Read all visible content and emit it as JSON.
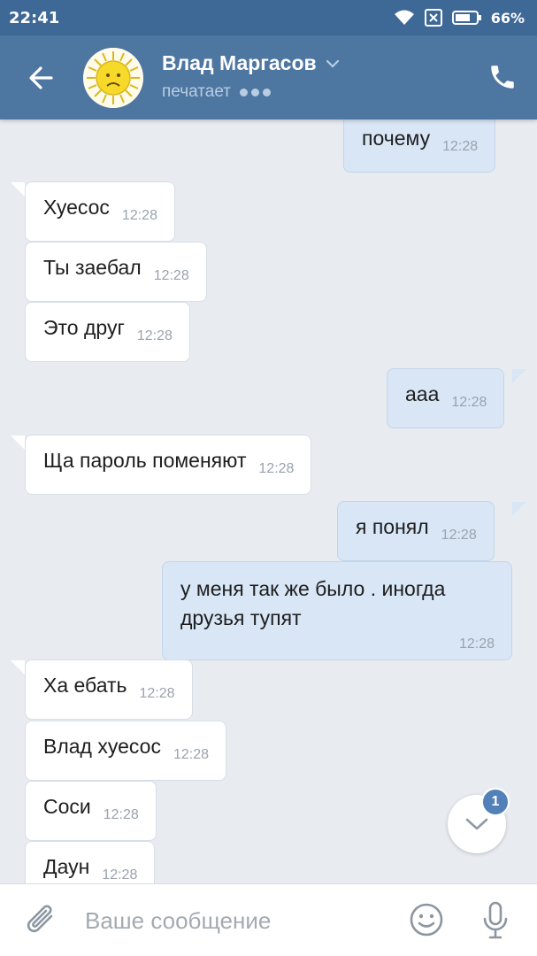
{
  "status_bar": {
    "time": "22:41",
    "battery": "66%",
    "icons": [
      "wifi-icon",
      "no-sim-icon",
      "battery-icon"
    ]
  },
  "header": {
    "contact_name": "Влад Маргасов",
    "status": "печатает",
    "icons": [
      "back-arrow-icon",
      "chevron-down-icon",
      "phone-icon"
    ]
  },
  "messages": [
    {
      "direction": "out",
      "text": "почему",
      "time": "12:28"
    },
    {
      "direction": "in",
      "text": "Хуесос",
      "time": "12:28"
    },
    {
      "direction": "in",
      "text": "Ты заебал",
      "time": "12:28"
    },
    {
      "direction": "in",
      "text": "Это друг",
      "time": "12:28"
    },
    {
      "direction": "out",
      "text": "ааа",
      "time": "12:28"
    },
    {
      "direction": "in",
      "text": "Ща пароль поменяют",
      "time": "12:28"
    },
    {
      "direction": "out",
      "text": "я понял",
      "time": "12:28"
    },
    {
      "direction": "out",
      "text": "у меня так же было . иногда друзья тупят",
      "time": "12:28"
    },
    {
      "direction": "in",
      "text": "Ха ебать",
      "time": "12:28"
    },
    {
      "direction": "in",
      "text": "Влад хуесос",
      "time": "12:28"
    },
    {
      "direction": "in",
      "text": "Соси",
      "time": "12:28"
    },
    {
      "direction": "in",
      "text": "Даун",
      "time": "12:28"
    }
  ],
  "scroll_down": {
    "unread_count": "1"
  },
  "composer": {
    "placeholder": "Ваше сообщение",
    "icons": [
      "paperclip-icon",
      "emoji-icon",
      "microphone-icon"
    ]
  },
  "colors": {
    "status_bar": "#3e6896",
    "header": "#4d76a1",
    "background": "#e8ecf1",
    "incoming_bubble": "#ffffff",
    "outgoing_bubble": "#d8e6f6",
    "badge": "#5181b8"
  }
}
